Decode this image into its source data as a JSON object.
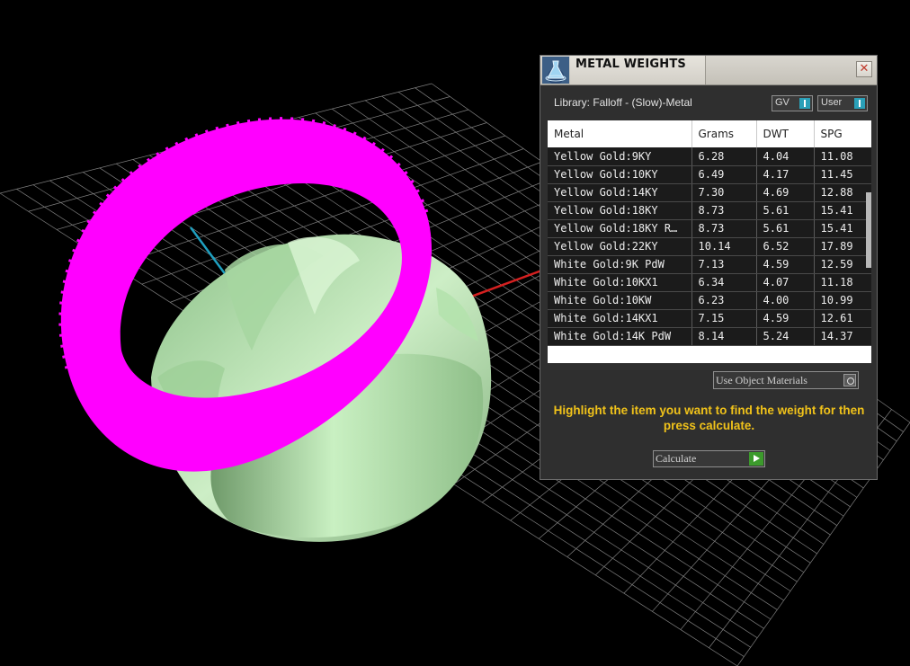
{
  "panel": {
    "title": "METAL WEIGHTS",
    "close_glyph": "✕",
    "library_label": "Library: Falloff - (Slow)-Metal",
    "toggles": {
      "gv": "GV",
      "user": "User"
    },
    "columns": [
      "Metal",
      "Grams",
      "DWT",
      "SPG"
    ],
    "rows": [
      [
        "Yellow Gold:9KY",
        "6.28",
        "4.04",
        "11.08"
      ],
      [
        "Yellow Gold:10KY",
        "6.49",
        "4.17",
        "11.45"
      ],
      [
        "Yellow Gold:14KY",
        "7.30",
        "4.69",
        "12.88"
      ],
      [
        "Yellow Gold:18KY",
        "8.73",
        "5.61",
        "15.41"
      ],
      [
        "Yellow Gold:18KY R…",
        "8.73",
        "5.61",
        "15.41"
      ],
      [
        "Yellow Gold:22KY",
        "10.14",
        "6.52",
        "17.89"
      ],
      [
        "White Gold:9K PdW",
        "7.13",
        "4.59",
        "12.59"
      ],
      [
        "White Gold:10KX1",
        "6.34",
        "4.07",
        "11.18"
      ],
      [
        "White Gold:10KW",
        "6.23",
        "4.00",
        "10.99"
      ],
      [
        "White Gold:14KX1",
        "7.15",
        "4.59",
        "12.61"
      ],
      [
        "White Gold:14K PdW",
        "8.14",
        "5.24",
        "14.37"
      ]
    ],
    "use_object_materials": "Use Object Materials",
    "instruction": "Highlight the item you want to find the weight for then press calculate.",
    "calculate_label": "Calculate"
  },
  "icons": {
    "app_icon": "metal-weights-flask-icon",
    "use_object_icon": "settings-knob-icon",
    "calculate_icon": "play-arrow-icon",
    "close_icon": "close-icon"
  },
  "colors": {
    "highlight_ring": "#ff00ff",
    "model_ring": "#b7eab0",
    "instruction_text": "#f0c21a",
    "toggle_accent": "#2aa0b8",
    "calculate_accent": "#3c9a2c",
    "panel_bg": "#2f2f2f",
    "axis_x": "#d42020",
    "axis_z": "#1fa0c0"
  }
}
